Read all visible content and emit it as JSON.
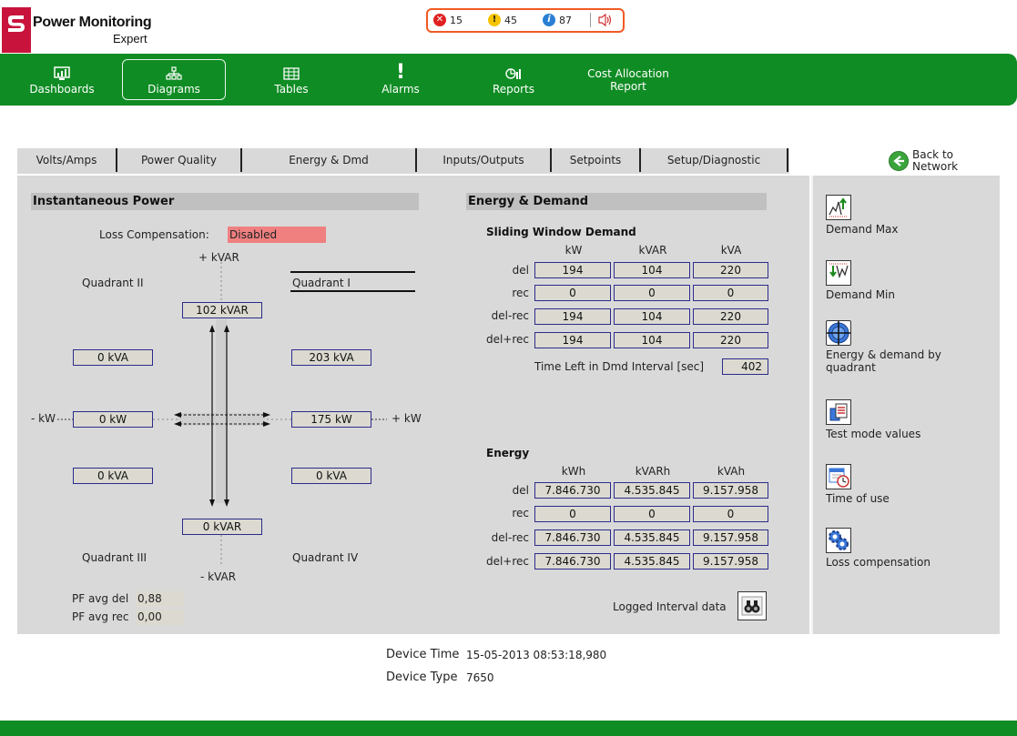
{
  "header": {
    "brand_line1": "Power Monitoring",
    "brand_line2": "Expert",
    "alarms": {
      "critical": "15",
      "warning": "45",
      "info": "87"
    }
  },
  "nav": {
    "items": [
      {
        "label": "Dashboards"
      },
      {
        "label": "Diagrams"
      },
      {
        "label": "Tables"
      },
      {
        "label": "Alarms"
      },
      {
        "label": "Reports"
      },
      {
        "label_line1": "Cost Allocation",
        "label_line2": "Report"
      }
    ]
  },
  "tabs": [
    "Volts/Amps",
    "Power Quality",
    "Energy & Dmd",
    "Inputs/Outputs",
    "Setpoints",
    "Setup/Diagnostic"
  ],
  "back": {
    "line1": "Back to",
    "line2": "Network"
  },
  "instantaneous": {
    "title": "Instantaneous Power",
    "loss_label": "Loss Compensation:",
    "loss_value": "Disabled",
    "plus_kvar": "+ kVAR",
    "minus_kvar": "- kVAR",
    "minus_kw": "- kW",
    "plus_kw": "+ kW",
    "q1": "Quadrant I",
    "q2": "Quadrant II",
    "q3": "Quadrant III",
    "q4": "Quadrant IV",
    "kvar_top": "102 kVAR",
    "kvar_bottom": "0 kVAR",
    "kva_q2": "0 kVA",
    "kva_q1": "203 kVA",
    "kva_q3": "0 kVA",
    "kva_q4": "0 kVA",
    "kw_left": "0 kW",
    "kw_right": "175 kW",
    "pf_del_label": "PF avg del",
    "pf_del_value": "0,88",
    "pf_rec_label": "PF avg rec",
    "pf_rec_value": "0,00"
  },
  "energy_demand": {
    "title": "Energy & Demand",
    "sliding_title": "Sliding Window Demand",
    "sliding_cols": [
      "kW",
      "kVAR",
      "kVA"
    ],
    "sliding_rows": [
      {
        "label": "del",
        "values": [
          "194",
          "104",
          "220"
        ]
      },
      {
        "label": "rec",
        "values": [
          "0",
          "0",
          "0"
        ]
      },
      {
        "label": "del-rec",
        "values": [
          "194",
          "104",
          "220"
        ]
      },
      {
        "label": "del+rec",
        "values": [
          "194",
          "104",
          "220"
        ]
      }
    ],
    "time_left_label": "Time Left in Dmd Interval [sec]",
    "time_left_value": "402",
    "energy_title": "Energy",
    "energy_cols": [
      "kWh",
      "kVARh",
      "kVAh"
    ],
    "energy_rows": [
      {
        "label": "del",
        "values": [
          "7.846.730",
          "4.535.845",
          "9.157.958"
        ]
      },
      {
        "label": "rec",
        "values": [
          "0",
          "0",
          "0"
        ]
      },
      {
        "label": "del-rec",
        "values": [
          "7.846.730",
          "4.535.845",
          "9.157.958"
        ]
      },
      {
        "label": "del+rec",
        "values": [
          "7.846.730",
          "4.535.845",
          "9.157.958"
        ]
      }
    ],
    "logged_label": "Logged Interval data"
  },
  "side_links": [
    {
      "label": "Demand Max"
    },
    {
      "label": "Demand Min"
    },
    {
      "label_line1": "Energy & demand by",
      "label_line2": "quadrant"
    },
    {
      "label": "Test mode values"
    },
    {
      "label": "Time of use"
    },
    {
      "label": "Loss compensation"
    }
  ],
  "device": {
    "time_label": "Device Time",
    "time_value": "15-05-2013 08:53:18,980",
    "type_label": "Device Type",
    "type_value": "7650"
  }
}
